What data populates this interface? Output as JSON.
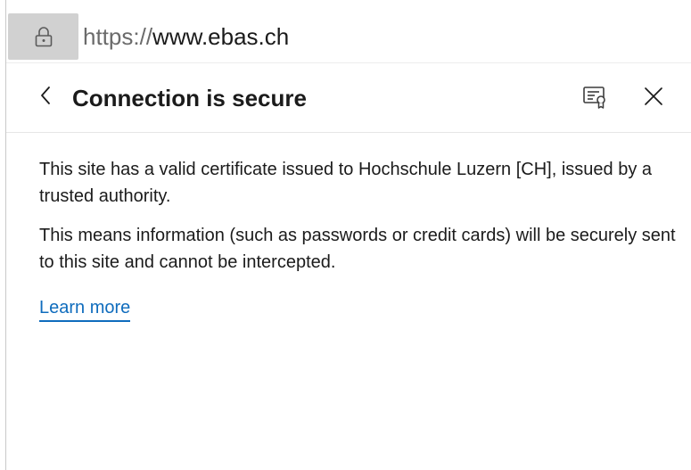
{
  "address_bar": {
    "url_prefix": "https://",
    "url_domain": "www.ebas.ch",
    "lock_icon": "lock-icon"
  },
  "flyout": {
    "title": "Connection is secure",
    "back_icon": "chevron-left-icon",
    "certificate_icon": "certificate-icon",
    "close_icon": "close-icon",
    "paragraphs": [
      "This site has a valid certificate issued to Hochschule Luzern [CH], issued by a trusted authority.",
      "This means information (such as passwords or credit cards) will be securely sent to this site and cannot be intercepted."
    ],
    "learn_more": "Learn more"
  },
  "colors": {
    "link": "#0f6cbd",
    "text": "#1b1b1b",
    "lock_button_bg": "#d1d1d1"
  }
}
